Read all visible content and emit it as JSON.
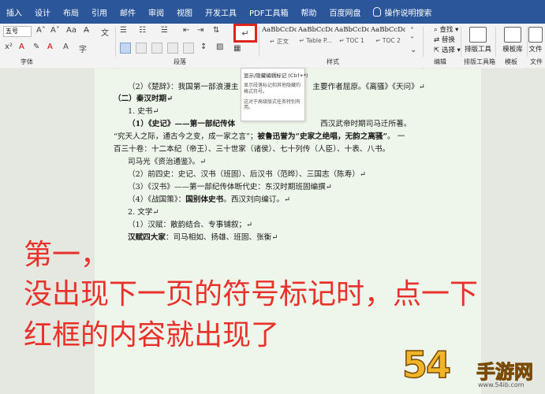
{
  "menubar": {
    "items": [
      "插入",
      "设计",
      "布局",
      "引用",
      "邮件",
      "审阅",
      "视图",
      "开发工具",
      "PDF工具箱",
      "帮助",
      "百度网盘"
    ],
    "search": "操作说明搜索"
  },
  "ribbon": {
    "font_size": "五号",
    "group_labels": {
      "font": "字体",
      "paragraph": "段落",
      "styles": "样式",
      "editing": "编辑",
      "layout_tools": "排版工具箱",
      "templates": "模板",
      "file": "文件"
    },
    "styles": [
      {
        "sample": "AaBbCcDd",
        "name": "↵ 正文"
      },
      {
        "sample": "AaBbCcDd",
        "name": "↵ Table P..."
      },
      {
        "sample": "AaBbCcDd",
        "name": "↵ TOC 1"
      },
      {
        "sample": "AaBbCcDd",
        "name": "↵ TOC 2"
      }
    ],
    "editing": {
      "find": "查找",
      "replace": "替换",
      "select": "选择"
    },
    "big_tools": {
      "layout": "排版工具",
      "template": "模板库",
      "file": "文件"
    }
  },
  "tooltip": {
    "title": "显示/隐藏编辑标记 (Ctrl+*)",
    "desc1": "显示段落标记和其他隐藏的格式符号。",
    "desc2": "这对于高级版式任务特别有用。"
  },
  "document": {
    "lines": [
      {
        "text": "（2）《楚辞》：我国第一部浪漫主",
        "tail": "主要作者屈原。《离骚》《天问》↵"
      },
      {
        "text": "（二）秦汉时期↵"
      },
      {
        "text": "1. 史书↵"
      },
      {
        "text": "（1）《史记》——第一部纪传体",
        "tail": "西汉武帝时期司马迁所著。"
      },
      {
        "text": "“究天人之际，通古今之变，成一家之言”；",
        "bold": "被鲁迅誉为“史家之绝唱，无韵之离骚”",
        "tail": "。 一"
      },
      {
        "text": "百三十卷：十二本纪（帝王）、三十世家（诸侯）、七十列传（人臣）、十表、八书。"
      },
      {
        "text": "司马光《资治通鉴》。↵"
      },
      {
        "text": "（2）前四史：史记、汉书（班固）、后汉书（范晔）、三国志（陈寿）↵"
      },
      {
        "text": "（3）《汉书》——第一部纪传体断代史：东汉时期班固编撰↵"
      },
      {
        "text": "（4）《战国策》：",
        "bold": "国别体史书",
        "tail": "。西汉刘向编订。↵"
      },
      {
        "text": "2. 文学↵"
      },
      {
        "text": "（1）汉赋：散韵结合、专事铺叙；↵"
      },
      {
        "bold_lead": "汉赋四大家",
        "text": "：司马相如、扬雄、班固、张衡↵"
      }
    ]
  },
  "caption": {
    "line1": "第一，",
    "line2": "没出现下一页的符号标记时，点一下",
    "line3": "红框的内容就出现了"
  },
  "watermark": {
    "number": "54",
    "brand": "手游网",
    "url": "www.54ib.com"
  },
  "colors": {
    "menubar": "#2b579a",
    "highlight_box": "#e0231c",
    "caption": "#e8312a"
  }
}
